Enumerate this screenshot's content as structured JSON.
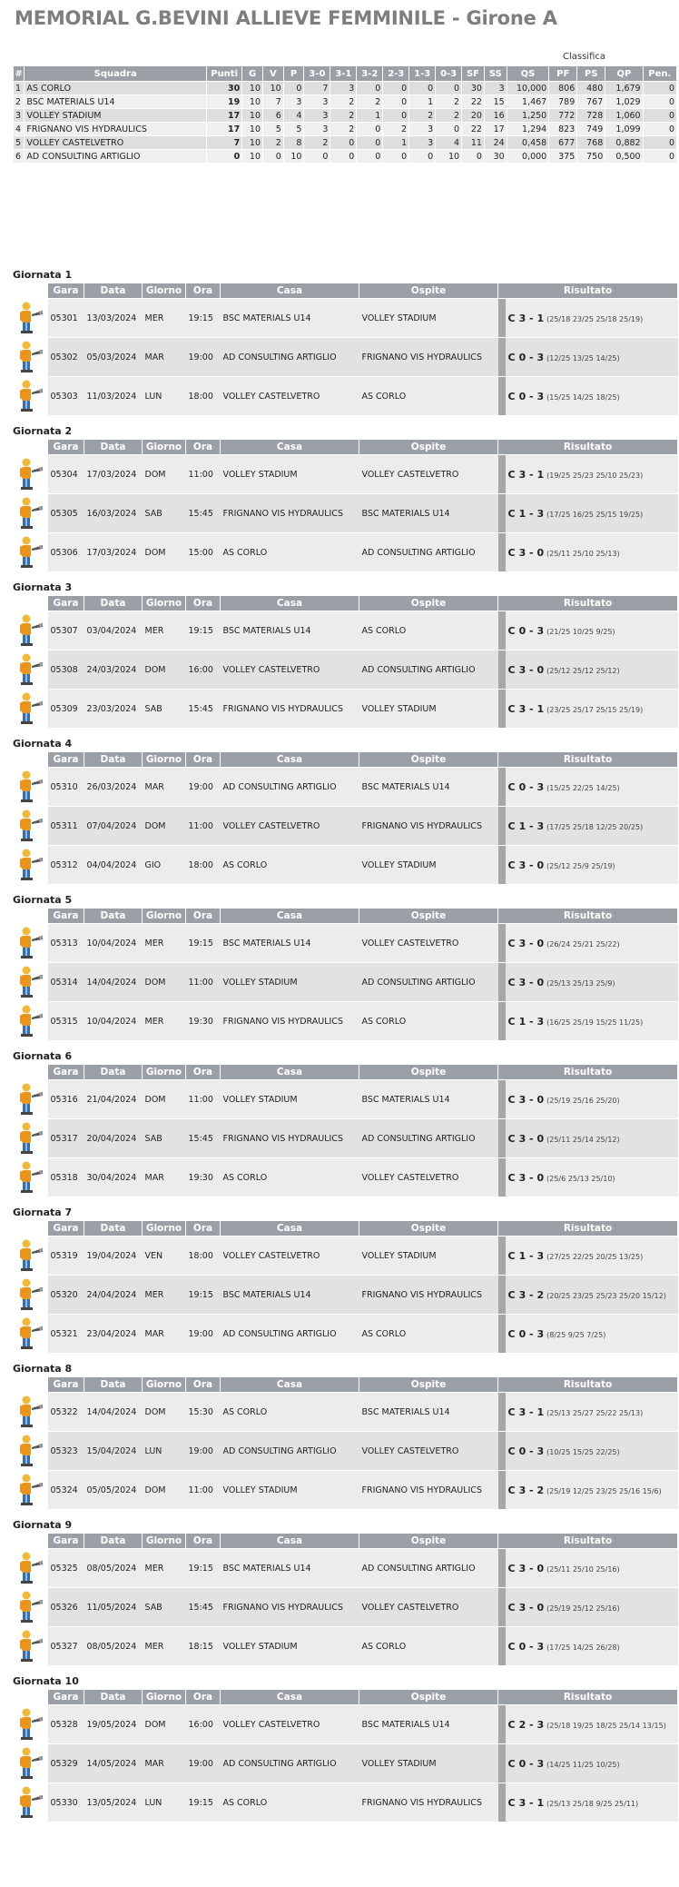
{
  "page": {
    "title": "MEMORIAL G.BEVINI ALLIEVE FEMMINILE - Girone A"
  },
  "standings": {
    "caption": "Classifica",
    "headers": [
      "#",
      "Squadra",
      "Punti",
      "G",
      "V",
      "P",
      "3-0",
      "3-1",
      "3-2",
      "2-3",
      "1-3",
      "0-3",
      "SF",
      "SS",
      "QS",
      "PF",
      "PS",
      "QP",
      "Pen."
    ],
    "rows": [
      [
        "1",
        "AS CORLO",
        "30",
        "10",
        "10",
        "0",
        "7",
        "3",
        "0",
        "0",
        "0",
        "0",
        "30",
        "3",
        "10,000",
        "806",
        "480",
        "1,679",
        "0"
      ],
      [
        "2",
        "BSC MATERIALS U14",
        "19",
        "10",
        "7",
        "3",
        "3",
        "2",
        "2",
        "0",
        "1",
        "2",
        "22",
        "15",
        "1,467",
        "789",
        "767",
        "1,029",
        "0"
      ],
      [
        "3",
        "VOLLEY STADIUM",
        "17",
        "10",
        "6",
        "4",
        "3",
        "2",
        "1",
        "0",
        "2",
        "2",
        "20",
        "16",
        "1,250",
        "772",
        "728",
        "1,060",
        "0"
      ],
      [
        "4",
        "FRIGNANO VIS HYDRAULICS",
        "17",
        "10",
        "5",
        "5",
        "3",
        "2",
        "0",
        "2",
        "3",
        "0",
        "22",
        "17",
        "1,294",
        "823",
        "749",
        "1,099",
        "0"
      ],
      [
        "5",
        "VOLLEY CASTELVETRO",
        "7",
        "10",
        "2",
        "8",
        "2",
        "0",
        "0",
        "1",
        "3",
        "4",
        "11",
        "24",
        "0,458",
        "677",
        "768",
        "0,882",
        "0"
      ],
      [
        "6",
        "AD CONSULTING ARTIGLIO",
        "0",
        "10",
        "0",
        "10",
        "0",
        "0",
        "0",
        "0",
        "0",
        "10",
        "0",
        "30",
        "0,000",
        "375",
        "750",
        "0,500",
        "0"
      ]
    ]
  },
  "games_headers": [
    "Gara",
    "Data",
    "Giorno",
    "Ora",
    "Casa",
    "Ospite",
    "Risultato"
  ],
  "rounds": [
    {
      "title": "Giornata 1",
      "games": [
        {
          "gara": "05301",
          "data": "13/03/2024",
          "giorno": "MER",
          "ora": "19:15",
          "casa": "BSC MATERIALS U14",
          "ospite": "VOLLEY STADIUM",
          "flag": "C",
          "score": "3 - 1",
          "sets": "(25/18 23/25 25/18 25/19)"
        },
        {
          "gara": "05302",
          "data": "05/03/2024",
          "giorno": "MAR",
          "ora": "19:00",
          "casa": "AD CONSULTING ARTIGLIO",
          "ospite": "FRIGNANO VIS HYDRAULICS",
          "flag": "C",
          "score": "0 - 3",
          "sets": "(12/25 13/25 14/25)"
        },
        {
          "gara": "05303",
          "data": "11/03/2024",
          "giorno": "LUN",
          "ora": "18:00",
          "casa": "VOLLEY CASTELVETRO",
          "ospite": "AS CORLO",
          "flag": "C",
          "score": "0 - 3",
          "sets": "(15/25 14/25 18/25)"
        }
      ]
    },
    {
      "title": "Giornata 2",
      "games": [
        {
          "gara": "05304",
          "data": "17/03/2024",
          "giorno": "DOM",
          "ora": "11:00",
          "casa": "VOLLEY STADIUM",
          "ospite": "VOLLEY CASTELVETRO",
          "flag": "C",
          "score": "3 - 1",
          "sets": "(19/25 25/23 25/10 25/23)"
        },
        {
          "gara": "05305",
          "data": "16/03/2024",
          "giorno": "SAB",
          "ora": "15:45",
          "casa": "FRIGNANO VIS HYDRAULICS",
          "ospite": "BSC MATERIALS U14",
          "flag": "C",
          "score": "1 - 3",
          "sets": "(17/25 16/25 25/15 19/25)"
        },
        {
          "gara": "05306",
          "data": "17/03/2024",
          "giorno": "DOM",
          "ora": "15:00",
          "casa": "AS CORLO",
          "ospite": "AD CONSULTING ARTIGLIO",
          "flag": "C",
          "score": "3 - 0",
          "sets": "(25/11 25/10 25/13)"
        }
      ]
    },
    {
      "title": "Giornata 3",
      "games": [
        {
          "gara": "05307",
          "data": "03/04/2024",
          "giorno": "MER",
          "ora": "19:15",
          "casa": "BSC MATERIALS U14",
          "ospite": "AS CORLO",
          "flag": "C",
          "score": "0 - 3",
          "sets": "(21/25 10/25 9/25)"
        },
        {
          "gara": "05308",
          "data": "24/03/2024",
          "giorno": "DOM",
          "ora": "16:00",
          "casa": "VOLLEY CASTELVETRO",
          "ospite": "AD CONSULTING ARTIGLIO",
          "flag": "C",
          "score": "3 - 0",
          "sets": "(25/12 25/12 25/12)"
        },
        {
          "gara": "05309",
          "data": "23/03/2024",
          "giorno": "SAB",
          "ora": "15:45",
          "casa": "FRIGNANO VIS HYDRAULICS",
          "ospite": "VOLLEY STADIUM",
          "flag": "C",
          "score": "3 - 1",
          "sets": "(23/25 25/17 25/15 25/19)"
        }
      ]
    },
    {
      "title": "Giornata 4",
      "games": [
        {
          "gara": "05310",
          "data": "26/03/2024",
          "giorno": "MAR",
          "ora": "19:00",
          "casa": "AD CONSULTING ARTIGLIO",
          "ospite": "BSC MATERIALS U14",
          "flag": "C",
          "score": "0 - 3",
          "sets": "(15/25 22/25 14/25)"
        },
        {
          "gara": "05311",
          "data": "07/04/2024",
          "giorno": "DOM",
          "ora": "11:00",
          "casa": "VOLLEY CASTELVETRO",
          "ospite": "FRIGNANO VIS HYDRAULICS",
          "flag": "C",
          "score": "1 - 3",
          "sets": "(17/25 25/18 12/25 20/25)"
        },
        {
          "gara": "05312",
          "data": "04/04/2024",
          "giorno": "GIO",
          "ora": "18:00",
          "casa": "AS CORLO",
          "ospite": "VOLLEY STADIUM",
          "flag": "C",
          "score": "3 - 0",
          "sets": "(25/12 25/9 25/19)"
        }
      ]
    },
    {
      "title": "Giornata 5",
      "games": [
        {
          "gara": "05313",
          "data": "10/04/2024",
          "giorno": "MER",
          "ora": "19:15",
          "casa": "BSC MATERIALS U14",
          "ospite": "VOLLEY CASTELVETRO",
          "flag": "C",
          "score": "3 - 0",
          "sets": "(26/24 25/21 25/22)"
        },
        {
          "gara": "05314",
          "data": "14/04/2024",
          "giorno": "DOM",
          "ora": "11:00",
          "casa": "VOLLEY STADIUM",
          "ospite": "AD CONSULTING ARTIGLIO",
          "flag": "C",
          "score": "3 - 0",
          "sets": "(25/13 25/13 25/9)"
        },
        {
          "gara": "05315",
          "data": "10/04/2024",
          "giorno": "MER",
          "ora": "19:30",
          "casa": "FRIGNANO VIS HYDRAULICS",
          "ospite": "AS CORLO",
          "flag": "C",
          "score": "1 - 3",
          "sets": "(16/25 25/19 15/25 11/25)"
        }
      ]
    },
    {
      "title": "Giornata 6",
      "games": [
        {
          "gara": "05316",
          "data": "21/04/2024",
          "giorno": "DOM",
          "ora": "11:00",
          "casa": "VOLLEY STADIUM",
          "ospite": "BSC MATERIALS U14",
          "flag": "C",
          "score": "3 - 0",
          "sets": "(25/19 25/16 25/20)"
        },
        {
          "gara": "05317",
          "data": "20/04/2024",
          "giorno": "SAB",
          "ora": "15:45",
          "casa": "FRIGNANO VIS HYDRAULICS",
          "ospite": "AD CONSULTING ARTIGLIO",
          "flag": "C",
          "score": "3 - 0",
          "sets": "(25/11 25/14 25/12)"
        },
        {
          "gara": "05318",
          "data": "30/04/2024",
          "giorno": "MAR",
          "ora": "19:30",
          "casa": "AS CORLO",
          "ospite": "VOLLEY CASTELVETRO",
          "flag": "C",
          "score": "3 - 0",
          "sets": "(25/6 25/13 25/10)"
        }
      ]
    },
    {
      "title": "Giornata 7",
      "games": [
        {
          "gara": "05319",
          "data": "19/04/2024",
          "giorno": "VEN",
          "ora": "18:00",
          "casa": "VOLLEY CASTELVETRO",
          "ospite": "VOLLEY STADIUM",
          "flag": "C",
          "score": "1 - 3",
          "sets": "(27/25 22/25 20/25 13/25)"
        },
        {
          "gara": "05320",
          "data": "24/04/2024",
          "giorno": "MER",
          "ora": "19:15",
          "casa": "BSC MATERIALS U14",
          "ospite": "FRIGNANO VIS HYDRAULICS",
          "flag": "C",
          "score": "3 - 2",
          "sets": "(20/25 23/25 25/23 25/20 15/12)"
        },
        {
          "gara": "05321",
          "data": "23/04/2024",
          "giorno": "MAR",
          "ora": "19:00",
          "casa": "AD CONSULTING ARTIGLIO",
          "ospite": "AS CORLO",
          "flag": "C",
          "score": "0 - 3",
          "sets": "(8/25 9/25 7/25)"
        }
      ]
    },
    {
      "title": "Giornata 8",
      "games": [
        {
          "gara": "05322",
          "data": "14/04/2024",
          "giorno": "DOM",
          "ora": "15:30",
          "casa": "AS CORLO",
          "ospite": "BSC MATERIALS U14",
          "flag": "C",
          "score": "3 - 1",
          "sets": "(25/13 25/27 25/22 25/13)"
        },
        {
          "gara": "05323",
          "data": "15/04/2024",
          "giorno": "LUN",
          "ora": "19:00",
          "casa": "AD CONSULTING ARTIGLIO",
          "ospite": "VOLLEY CASTELVETRO",
          "flag": "C",
          "score": "0 - 3",
          "sets": "(10/25 15/25 22/25)"
        },
        {
          "gara": "05324",
          "data": "05/05/2024",
          "giorno": "DOM",
          "ora": "11:00",
          "casa": "VOLLEY STADIUM",
          "ospite": "FRIGNANO VIS HYDRAULICS",
          "flag": "C",
          "score": "3 - 2",
          "sets": "(25/19 12/25 23/25 25/16 15/6)"
        }
      ]
    },
    {
      "title": "Giornata 9",
      "games": [
        {
          "gara": "05325",
          "data": "08/05/2024",
          "giorno": "MER",
          "ora": "19:15",
          "casa": "BSC MATERIALS U14",
          "ospite": "AD CONSULTING ARTIGLIO",
          "flag": "C",
          "score": "3 - 0",
          "sets": "(25/11 25/10 25/16)"
        },
        {
          "gara": "05326",
          "data": "11/05/2024",
          "giorno": "SAB",
          "ora": "15:45",
          "casa": "FRIGNANO VIS HYDRAULICS",
          "ospite": "VOLLEY CASTELVETRO",
          "flag": "C",
          "score": "3 - 0",
          "sets": "(25/19 25/12 25/16)"
        },
        {
          "gara": "05327",
          "data": "08/05/2024",
          "giorno": "MER",
          "ora": "18:15",
          "casa": "VOLLEY STADIUM",
          "ospite": "AS CORLO",
          "flag": "C",
          "score": "0 - 3",
          "sets": "(17/25 14/25 26/28)"
        }
      ]
    },
    {
      "title": "Giornata 10",
      "games": [
        {
          "gara": "05328",
          "data": "19/05/2024",
          "giorno": "DOM",
          "ora": "16:00",
          "casa": "VOLLEY CASTELVETRO",
          "ospite": "BSC MATERIALS U14",
          "flag": "C",
          "score": "2 - 3",
          "sets": "(25/18 19/25 18/25 25/14 13/15)"
        },
        {
          "gara": "05329",
          "data": "14/05/2024",
          "giorno": "MAR",
          "ora": "19:00",
          "casa": "AD CONSULTING ARTIGLIO",
          "ospite": "VOLLEY STADIUM",
          "flag": "C",
          "score": "0 - 3",
          "sets": "(14/25 11/25 10/25)"
        },
        {
          "gara": "05330",
          "data": "13/05/2024",
          "giorno": "LUN",
          "ora": "19:15",
          "casa": "AS CORLO",
          "ospite": "FRIGNANO VIS HYDRAULICS",
          "flag": "C",
          "score": "3 - 1",
          "sets": "(25/13 25/18 9/25 25/11)"
        }
      ]
    }
  ],
  "icons": {
    "referee": "referee-whistle-icon"
  }
}
